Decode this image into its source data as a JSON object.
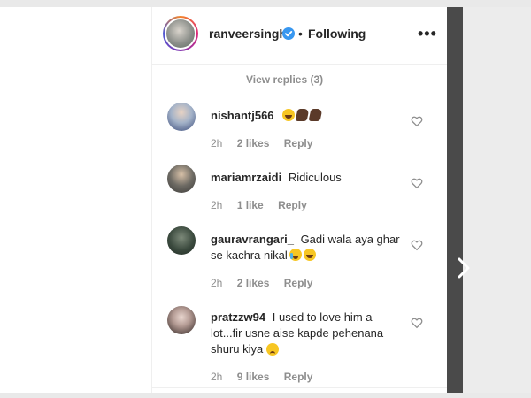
{
  "post_header": {
    "username": "ranveersingh",
    "separator": "•",
    "follow_status": "Following",
    "more_label": "•••"
  },
  "view_replies": {
    "label": "View replies (3)"
  },
  "comments": [
    {
      "username": "nishantj566",
      "text": "",
      "emojis": [
        "laughing-emoji",
        "hand-emoji",
        "hand-emoji"
      ],
      "time": "2h",
      "likes": "2 likes",
      "reply": "Reply"
    },
    {
      "username": "mariamrzaidi",
      "text": "Ridiculous",
      "time": "2h",
      "likes": "1 like",
      "reply": "Reply"
    },
    {
      "username": "gauravrangari_",
      "text": "Gadi wala aya ghar se kachra nikal",
      "emojis": [
        "crying-emoji",
        "laughing-emoji"
      ],
      "time": "2h",
      "likes": "2 likes",
      "reply": "Reply"
    },
    {
      "username": "pratzzw94",
      "text": "I used to love him a lot...fir usne aise kapde pehenana shuru kiya",
      "emojis": [
        "sad-emoji"
      ],
      "time": "2h",
      "likes": "9 likes",
      "reply": "Reply"
    }
  ],
  "icons": {
    "verified": "verified-badge-icon",
    "like": "heart-outline-icon",
    "next": "chevron-right-icon"
  },
  "colors": {
    "verified_blue": "#3897f0",
    "meta_gray": "#8e8e8e",
    "text_dark": "#262626"
  }
}
